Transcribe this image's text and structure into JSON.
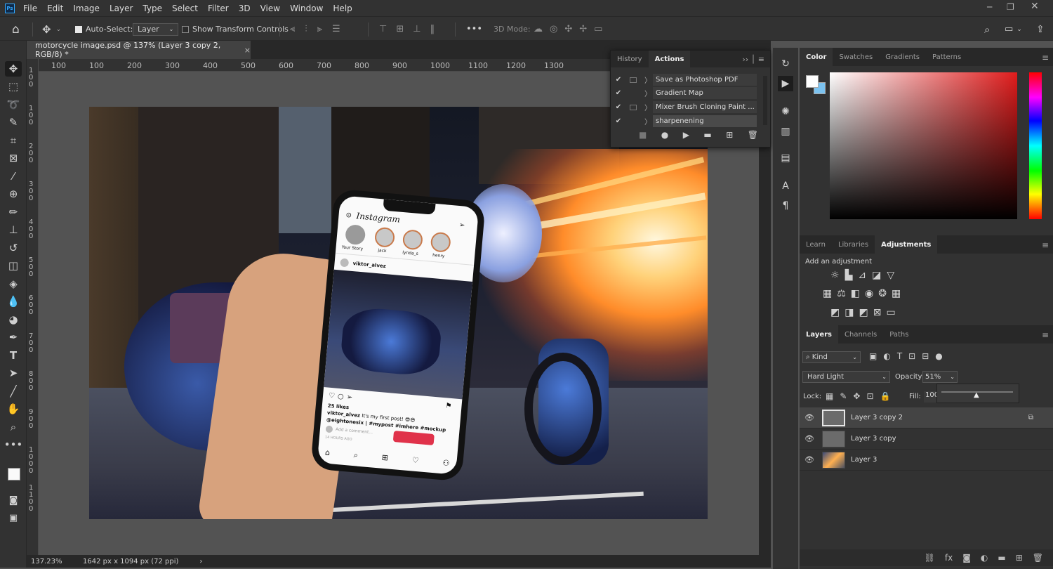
{
  "menu": {
    "logo": "Ps",
    "items": [
      "File",
      "Edit",
      "Image",
      "Layer",
      "Type",
      "Select",
      "Filter",
      "3D",
      "View",
      "Window",
      "Help"
    ]
  },
  "options": {
    "auto_select_label": "Auto-Select:",
    "auto_select_value": "Layer",
    "transform_label": "Show Transform Controls",
    "mode_3d": "3D Mode:",
    "more": "•••"
  },
  "document": {
    "tab_title": "motorcycle image.psd @ 137% (Layer 3 copy 2, RGB/8) *",
    "close": "×"
  },
  "ruler": {
    "top": [
      "100",
      "100",
      "200",
      "300",
      "400",
      "500",
      "600",
      "700",
      "800",
      "900",
      "1000",
      "1100",
      "1200",
      "1300"
    ],
    "left": [
      "1\n0\n0",
      "1\n0\n0",
      "2\n0\n0",
      "3\n0\n0",
      "4\n0\n0",
      "5\n0\n0",
      "6\n0\n0",
      "7\n0\n0",
      "8\n0\n0",
      "9\n0\n0",
      "1\n0\n0\n0",
      "1\n1\n0\n0"
    ]
  },
  "status": {
    "zoom": "137.23%",
    "size": "1642 px x 1094 px (72 ppi)",
    "arrow": "›"
  },
  "actions_panel": {
    "tabs": [
      "History",
      "Actions"
    ],
    "rows": [
      {
        "name": "Save as Photoshop PDF",
        "has_box": true
      },
      {
        "name": "Gradient Map",
        "has_box": false
      },
      {
        "name": "Mixer Brush Cloning Paint ...",
        "has_box": true
      },
      {
        "name": "sharpenening",
        "has_box": false
      }
    ]
  },
  "color_panel": {
    "tabs": [
      "Color",
      "Swatches",
      "Gradients",
      "Patterns"
    ]
  },
  "adjust_panel": {
    "tabs": [
      "Learn",
      "Libraries",
      "Adjustments"
    ],
    "add_label": "Add an adjustment"
  },
  "layers_panel": {
    "tabs": [
      "Layers",
      "Channels",
      "Paths"
    ],
    "kind": "Kind",
    "blend_mode": "Hard Light",
    "opacity_label": "Opacity:",
    "opacity_value": "51%",
    "lock_label": "Lock:",
    "fill_label": "Fill:",
    "fill_value": "100",
    "layers": [
      {
        "name": "Layer 3 copy 2",
        "selected": true
      },
      {
        "name": "Layer 3 copy",
        "selected": false
      },
      {
        "name": "Layer 3",
        "selected": false
      }
    ]
  },
  "phone": {
    "app": "Instagram",
    "stories": [
      "Your Story",
      "jack",
      "lynda_s",
      "henry"
    ],
    "user": "viktor_alvez",
    "likes": "25 likes",
    "caption_user": "viktor_alvez",
    "caption": "It's my first post! 😎😎",
    "tags": "@eightonesix | #mypost #imhere #mockup",
    "comment_placeholder": "Add a comment...",
    "time": "14 HOURS AGO"
  },
  "colors": {
    "accent": "#31a8ff",
    "panel": "#323232",
    "dark": "#282828",
    "canvas": "#535353"
  }
}
